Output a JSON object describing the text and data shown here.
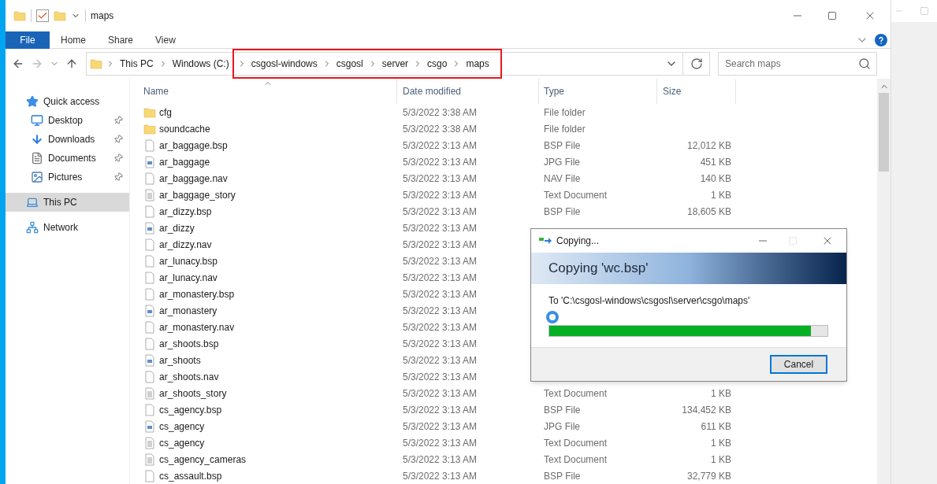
{
  "window": {
    "title": "maps"
  },
  "ribbon_tabs": [
    {
      "label": "File",
      "kind": "file"
    },
    {
      "label": "Home",
      "kind": "tab"
    },
    {
      "label": "Share",
      "kind": "tab"
    },
    {
      "label": "View",
      "kind": "tab"
    }
  ],
  "address": {
    "crumbs": [
      {
        "label": "This PC",
        "highlighted": false
      },
      {
        "label": "Windows (C:)",
        "highlighted": false
      },
      {
        "label": "csgosl-windows",
        "highlighted": true
      },
      {
        "label": "csgosl",
        "highlighted": true
      },
      {
        "label": "server",
        "highlighted": true
      },
      {
        "label": "csgo",
        "highlighted": true
      },
      {
        "label": "maps",
        "highlighted": true
      }
    ]
  },
  "search": {
    "placeholder": "Search maps"
  },
  "sidebar": {
    "items": [
      {
        "label": "Quick access",
        "kind": "star",
        "selected": false,
        "children": [
          {
            "label": "Desktop",
            "kind": "desktop",
            "pinned": true,
            "selected": false
          },
          {
            "label": "Downloads",
            "kind": "download",
            "pinned": true,
            "selected": false
          },
          {
            "label": "Documents",
            "kind": "document",
            "pinned": true,
            "selected": false
          },
          {
            "label": "Pictures",
            "kind": "picture",
            "pinned": true,
            "selected": false
          }
        ]
      },
      {
        "label": "This PC",
        "kind": "pc",
        "selected": true
      },
      {
        "label": "Network",
        "kind": "network",
        "selected": false
      }
    ]
  },
  "table": {
    "columns": [
      {
        "label": "Name",
        "sorted": true
      },
      {
        "label": "Date modified",
        "sorted": false
      },
      {
        "label": "Type",
        "sorted": false
      },
      {
        "label": "Size",
        "sorted": false
      }
    ],
    "rows": [
      {
        "name": "cfg",
        "kind": "folder",
        "date": "5/3/2022 3:38 AM",
        "type": "File folder"
      },
      {
        "name": "soundcache",
        "kind": "folder",
        "date": "5/3/2022 3:38 AM",
        "type": "File folder"
      },
      {
        "name": "ar_baggage.bsp",
        "kind": "file",
        "date": "5/3/2022 3:13 AM",
        "type": "BSP File",
        "size": "12,012 KB"
      },
      {
        "name": "ar_baggage",
        "kind": "image",
        "date": "5/3/2022 3:13 AM",
        "type": "JPG File",
        "size": "451 KB"
      },
      {
        "name": "ar_baggage.nav",
        "kind": "file",
        "date": "5/3/2022 3:13 AM",
        "type": "NAV File",
        "size": "140 KB"
      },
      {
        "name": "ar_baggage_story",
        "kind": "text",
        "date": "5/3/2022 3:13 AM",
        "type": "Text Document",
        "size": "1 KB"
      },
      {
        "name": "ar_dizzy.bsp",
        "kind": "file",
        "date": "5/3/2022 3:13 AM",
        "type": "BSP File",
        "size": "18,605 KB"
      },
      {
        "name": "ar_dizzy",
        "kind": "image",
        "date": "5/3/2022 3:13 AM"
      },
      {
        "name": "ar_dizzy.nav",
        "kind": "file",
        "date": "5/3/2022 3:13 AM"
      },
      {
        "name": "ar_lunacy.bsp",
        "kind": "file",
        "date": "5/3/2022 3:13 AM"
      },
      {
        "name": "ar_lunacy.nav",
        "kind": "file",
        "date": "5/3/2022 3:13 AM"
      },
      {
        "name": "ar_monastery.bsp",
        "kind": "file",
        "date": "5/3/2022 3:13 AM"
      },
      {
        "name": "ar_monastery",
        "kind": "image",
        "date": "5/3/2022 3:13 AM"
      },
      {
        "name": "ar_monastery.nav",
        "kind": "file",
        "date": "5/3/2022 3:13 AM"
      },
      {
        "name": "ar_shoots.bsp",
        "kind": "file",
        "date": "5/3/2022 3:13 AM"
      },
      {
        "name": "ar_shoots",
        "kind": "image",
        "date": "5/3/2022 3:13 AM"
      },
      {
        "name": "ar_shoots.nav",
        "kind": "file",
        "date": "5/3/2022 3:13 AM"
      },
      {
        "name": "ar_shoots_story",
        "kind": "text",
        "date": "5/3/2022 3:13 AM",
        "type": "Text Document",
        "size": "1 KB"
      },
      {
        "name": "cs_agency.bsp",
        "kind": "file",
        "date": "5/3/2022 3:13 AM",
        "type": "BSP File",
        "size": "134,452 KB"
      },
      {
        "name": "cs_agency",
        "kind": "image",
        "date": "5/3/2022 3:13 AM",
        "type": "JPG File",
        "size": "611 KB"
      },
      {
        "name": "cs_agency",
        "kind": "text",
        "date": "5/3/2022 3:13 AM",
        "type": "Text Document",
        "size": "1 KB"
      },
      {
        "name": "cs_agency_cameras",
        "kind": "text",
        "date": "5/3/2022 3:13 AM",
        "type": "Text Document",
        "size": "1 KB"
      },
      {
        "name": "cs_assault.bsp",
        "kind": "file",
        "date": "5/3/2022 3:13 AM",
        "type": "BSP File",
        "size": "32,779 KB"
      }
    ]
  },
  "dialog": {
    "title": "Copying...",
    "heading": "Copying 'wc.bsp'",
    "destination": "To 'C:\\csgosl-windows\\csgosl\\server\\csgo\\maps'",
    "level": 0.94,
    "button": "Cancel"
  }
}
